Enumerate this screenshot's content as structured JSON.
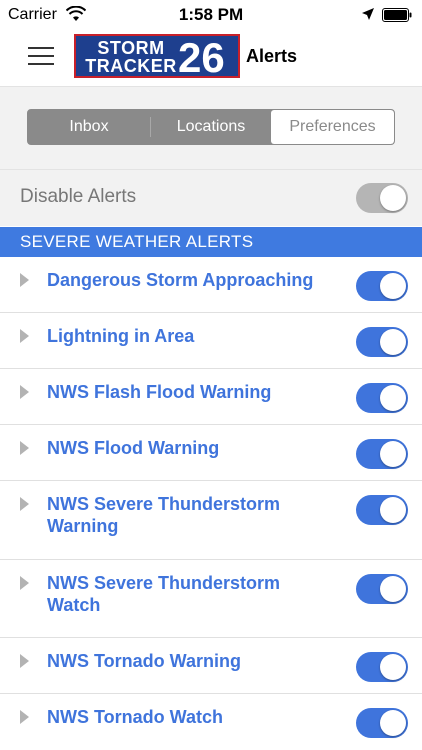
{
  "status_bar": {
    "carrier": "Carrier",
    "time": "1:58 PM"
  },
  "nav": {
    "menu_icon": "hamburger-icon",
    "logo_line1": "STORM",
    "logo_line2": "TRACKER",
    "logo_number": "26",
    "title": "Alerts"
  },
  "tabs": [
    "Inbox",
    "Locations",
    "Preferences"
  ],
  "selected_tab": "Preferences",
  "disable_alerts": {
    "label": "Disable Alerts",
    "enabled": false
  },
  "section": {
    "title": "SEVERE WEATHER ALERTS"
  },
  "alerts": [
    {
      "label": "Dangerous Storm Approaching",
      "enabled": true
    },
    {
      "label": "Lightning in Area",
      "enabled": true
    },
    {
      "label": "NWS Flash Flood Warning",
      "enabled": true
    },
    {
      "label": "NWS Flood Warning",
      "enabled": true
    },
    {
      "label": "NWS Severe Thunderstorm Warning",
      "enabled": true
    },
    {
      "label": "NWS Severe Thunderstorm Watch",
      "enabled": true
    },
    {
      "label": "NWS Tornado Warning",
      "enabled": true
    },
    {
      "label": "NWS Tornado Watch",
      "enabled": true
    }
  ],
  "colors": {
    "accent": "#3f74dc",
    "section_header": "#3f7ae0",
    "logo_bg": "#1e3f8e",
    "logo_border": "#c8202a"
  }
}
